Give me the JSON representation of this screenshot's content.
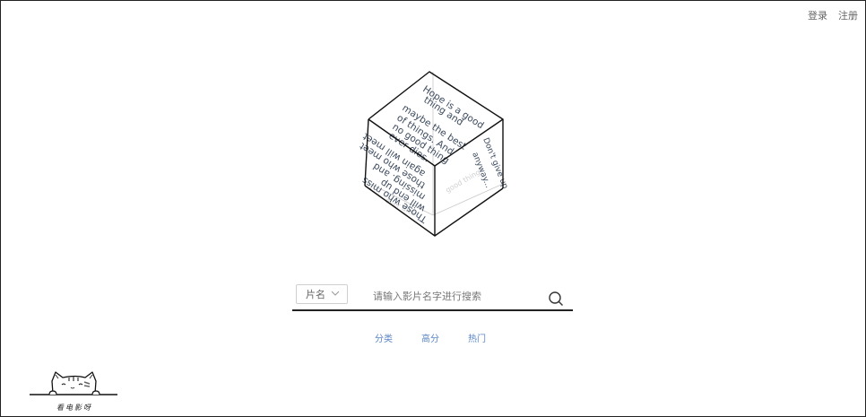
{
  "header": {
    "login_label": "登录",
    "register_label": "注册"
  },
  "cube": {
    "top_face_text": [
      "Hope is a good",
      "thing and",
      "maybe the best",
      "of things. And",
      "no good thing",
      "ever dies."
    ],
    "left_face_text": [
      "Those who miss",
      "will end up",
      "missing. and",
      "those who meet",
      "again will meet"
    ],
    "right_face_text": [
      "Don't give up",
      "anyway..."
    ]
  },
  "search": {
    "type_selected": "片名",
    "placeholder": "请输入影片名字进行搜索"
  },
  "nav": {
    "items": [
      "分类",
      "高分",
      "热门"
    ]
  },
  "logo": {
    "text": "看电影呀"
  },
  "colors": {
    "nav_link": "#5a86c5",
    "text_muted": "#666666",
    "border": "#222222"
  }
}
